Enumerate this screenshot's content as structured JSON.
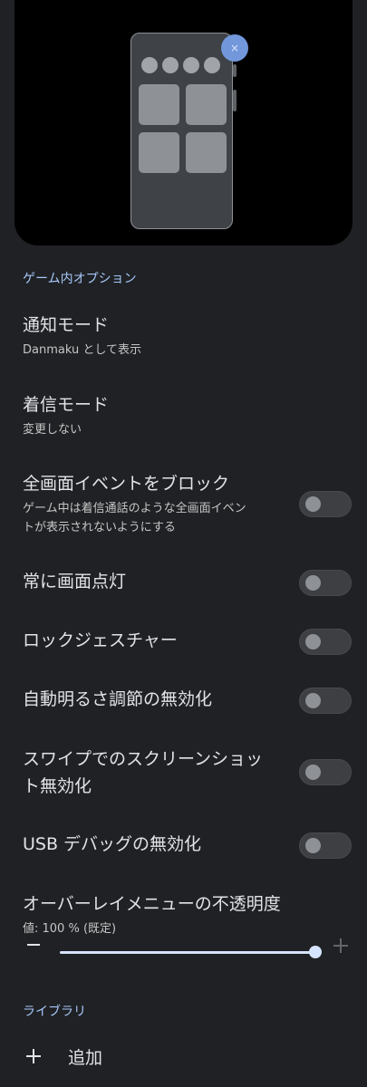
{
  "preview": {
    "fab_icon": "×"
  },
  "sections": {
    "game_options": "ゲーム内オプション",
    "library": "ライブラリ"
  },
  "settings": {
    "notification_mode": {
      "title": "通知モード",
      "summary": "Danmaku として表示"
    },
    "call_mode": {
      "title": "着信モード",
      "summary": "変更しない"
    },
    "block_fullscreen": {
      "title": "全画面イベントをブロック",
      "summary_line1": "ゲーム中は着信通話のような全画面イベン",
      "summary_line2": "トが表示されないようにする",
      "enabled": false
    },
    "screen_on": {
      "title": "常に画面点灯",
      "enabled": false
    },
    "lock_gesture": {
      "title": "ロックジェスチャー",
      "enabled": false
    },
    "disable_auto_brightness": {
      "title": "自動明るさ調節の無効化",
      "enabled": false
    },
    "disable_swipe_screenshot": {
      "title_line1": "スワイプでのスクリーンショッ",
      "title_line2": "ト無効化",
      "enabled": false
    },
    "disable_usb_debug": {
      "title": "USB デバッグの無効化",
      "enabled": false
    },
    "overlay_opacity": {
      "title": "オーバーレイメニューの不透明度",
      "summary": "値: 100 % (既定)",
      "value_percent": 100
    }
  },
  "library": {
    "add_label": "追加"
  },
  "colors": {
    "background": "#1f2124",
    "accent": "#a8c7fa",
    "slider": "#d6e3ff"
  }
}
